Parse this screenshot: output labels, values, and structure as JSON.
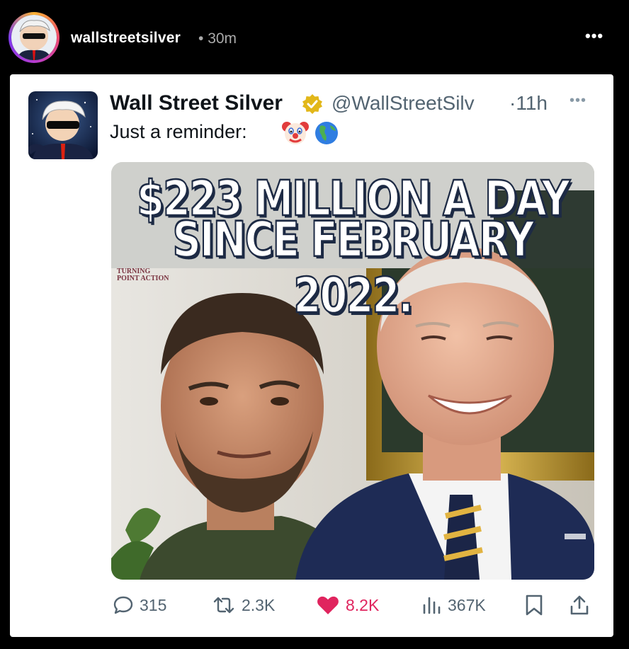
{
  "story": {
    "username": "wallstreetsilver",
    "separator": "•",
    "time": "30m",
    "more": "•••"
  },
  "tweet": {
    "display_name": "Wall Street Silver",
    "handle": "@WallStreetSilv",
    "time_sep": "·",
    "time": "11h",
    "more": "•••",
    "text": "Just a reminder:",
    "emojis": [
      "clown-face",
      "globe-americas"
    ],
    "verified_color": "#e2b719"
  },
  "media": {
    "headline_line1": "$223 MILLION A DAY",
    "headline_line2": "SINCE FEBRUARY 2022.",
    "logo_line1": "TURNING",
    "logo_line2": "POINT ACTION"
  },
  "actions": {
    "replies": "315",
    "reposts": "2.3K",
    "likes": "8.2K",
    "views": "367K",
    "like_color": "#e0245e"
  }
}
